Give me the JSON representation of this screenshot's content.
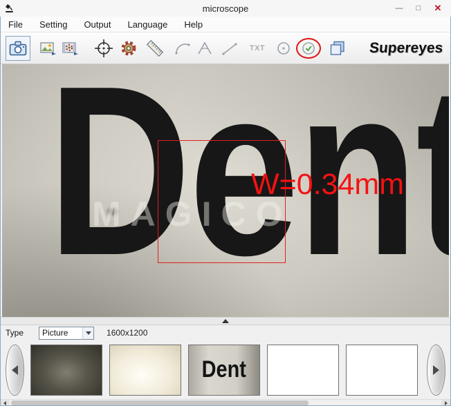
{
  "window": {
    "title": "microscope",
    "controls": {
      "minimize": "—",
      "maximize": "□",
      "close": "✕"
    }
  },
  "menu": {
    "items": [
      "File",
      "Setting",
      "Output",
      "Language",
      "Help"
    ]
  },
  "toolbar": {
    "brand": "Supereyes",
    "txt_tool_label": "TXT",
    "icons": [
      "snapshot-camera-icon",
      "export-photo-icon",
      "export-video-icon",
      "crosshair-icon",
      "settings-gear-icon",
      "ruler-icon",
      "arc-measure-icon",
      "angle-measure-icon",
      "line-measure-icon",
      "text-tool-icon",
      "circle-measure-icon",
      "confirm-circle-icon",
      "layers-copy-icon"
    ]
  },
  "viewer": {
    "specimen_text": "Dent",
    "watermark": "MAGICO",
    "measurement_label": "W=0.34mm"
  },
  "panel": {
    "type_label": "Type",
    "type_value": "Picture",
    "resolution": "1600x1200"
  },
  "thumbnails": {
    "dent_text": "Dent"
  },
  "colors": {
    "annotation_red": "#e01212",
    "measure_red": "#f51111",
    "accent_blue": "#2e5f96"
  }
}
